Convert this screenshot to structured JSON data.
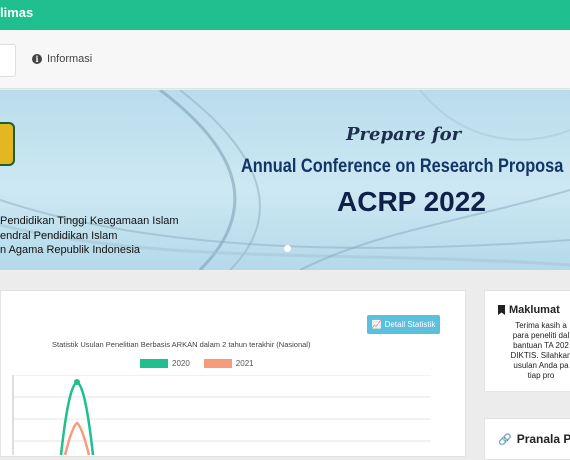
{
  "header": {
    "brand": "limas"
  },
  "nav": {
    "info_label": "Informasi",
    "info_icon": "info-circle-icon"
  },
  "banner": {
    "prepare": "Prepare for",
    "conference": "Annual Conference on Research Proposa",
    "acrp": "ACRP 2022",
    "lines": [
      "Pendidikan Tinggi Keagamaan Islam",
      "endral Pendidikan Islam",
      "n Agama Republik Indonesia"
    ]
  },
  "stats": {
    "button_label": "Detail Statistik",
    "title": "Statistik Usulan Penelitian Berbasis ARKAN dalam 2 tahun terakhir (Nasional)"
  },
  "chart_data": {
    "type": "line",
    "title": "Statistik Usulan Penelitian Berbasis ARKAN dalam 2 tahun terakhir (Nasional)",
    "series": [
      {
        "name": "2020",
        "color": "#1fbf8f"
      },
      {
        "name": "2021",
        "color": "#f79b7a"
      }
    ],
    "grid": true,
    "legend": "top"
  },
  "sidebar": {
    "maklumat_title": "Maklumat",
    "maklumat_lines": [
      "Terima kasih a",
      "para peneliti dal",
      "bantuan TA 202",
      "DIKTIS. Silahkan",
      "usulan Anda pa",
      "tiap pro"
    ],
    "pranala_title": "Pranala P"
  },
  "colors": {
    "accent": "#1fbf8f",
    "info_button": "#5bc0de"
  }
}
